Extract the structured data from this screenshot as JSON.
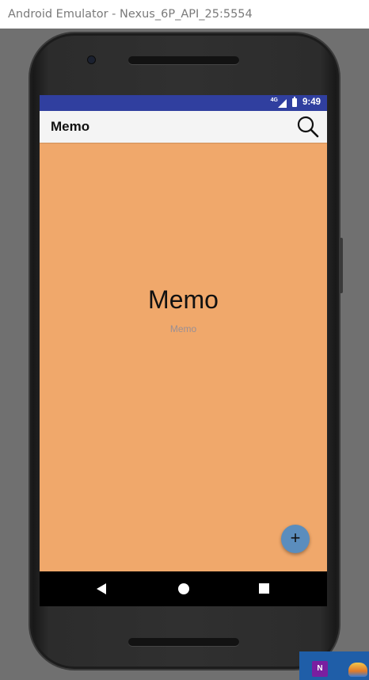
{
  "window": {
    "title": "Android Emulator - Nexus_6P_API_25:5554"
  },
  "status_bar": {
    "network": "4G",
    "time": "9:49"
  },
  "app_bar": {
    "title": "Memo",
    "search_icon": "search-icon"
  },
  "content": {
    "heading": "Memo",
    "subheading": "Memo"
  },
  "fab": {
    "label": "+",
    "icon": "plus-icon"
  },
  "nav_bar": {
    "back_icon": "back-icon",
    "home_icon": "home-icon",
    "recents_icon": "recents-icon"
  },
  "taskbar": {
    "ime_label": "N"
  },
  "colors": {
    "status_bar": "#303f9f",
    "app_bar": "#f4f4f4",
    "content_bg": "#f0a86b",
    "fab": "#5b8dbd"
  }
}
